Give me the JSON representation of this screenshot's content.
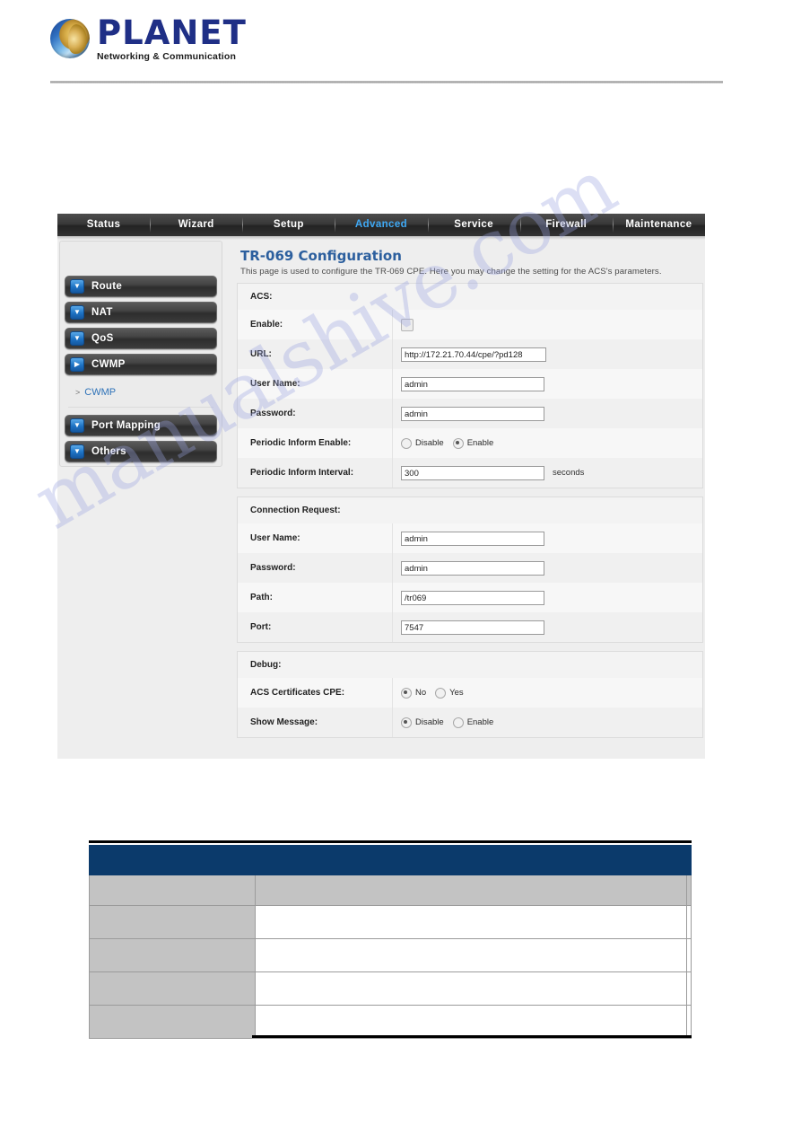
{
  "brand": {
    "name": "PLANET",
    "tagline": "Networking & Communication",
    "logo_icon": "globe-icon"
  },
  "navbar": {
    "tabs": [
      {
        "label": "Status",
        "active": false
      },
      {
        "label": "Wizard",
        "active": false
      },
      {
        "label": "Setup",
        "active": false
      },
      {
        "label": "Advanced",
        "active": true
      },
      {
        "label": "Service",
        "active": false
      },
      {
        "label": "Firewall",
        "active": false
      },
      {
        "label": "Maintenance",
        "active": false
      }
    ],
    "active_color": "#3fa9f5"
  },
  "sidebar": {
    "items": [
      {
        "label": "Route",
        "icon": "chevron-down-icon"
      },
      {
        "label": "NAT",
        "icon": "chevron-down-icon"
      },
      {
        "label": "QoS",
        "icon": "chevron-down-icon"
      },
      {
        "label": "CWMP",
        "icon": "chevron-right-icon"
      }
    ],
    "sub_items": [
      {
        "label": "CWMP",
        "marker": ">"
      }
    ],
    "items2": [
      {
        "label": "Port Mapping",
        "icon": "chevron-down-icon"
      },
      {
        "label": "Others",
        "icon": "chevron-down-icon"
      }
    ]
  },
  "page": {
    "title": "TR-069 Configuration",
    "description": "This page is used to configure the TR-069 CPE. Here you may change the setting for the ACS's parameters.",
    "title_color": "#2c5f9e"
  },
  "acs": {
    "group_label": "ACS:",
    "enable_label": "Enable:",
    "enable_checked": false,
    "url_label": "URL:",
    "url_value": "http://172.21.70.44/cpe/?pd128",
    "username_label": "User Name:",
    "username_value": "admin",
    "password_label": "Password:",
    "password_value": "admin",
    "periodic_inform_label": "Periodic Inform Enable:",
    "periodic_inform_options": [
      "Disable",
      "Enable"
    ],
    "periodic_inform_selected": "Enable",
    "interval_label": "Periodic Inform Interval:",
    "interval_value": "300",
    "interval_unit": "seconds"
  },
  "connection_request": {
    "group_label": "Connection Request:",
    "username_label": "User Name:",
    "username_value": "admin",
    "password_label": "Password:",
    "password_value": "admin",
    "path_label": "Path:",
    "path_value": "/tr069",
    "port_label": "Port:",
    "port_value": "7547"
  },
  "debug": {
    "group_label": "Debug:",
    "acs_cert_label": "ACS Certificates CPE:",
    "acs_cert_options": [
      "No",
      "Yes"
    ],
    "acs_cert_selected": "No",
    "show_message_label": "Show Message:",
    "show_message_options": [
      "Disable",
      "Enable"
    ],
    "show_message_selected": "Disable"
  },
  "watermark": {
    "text": "manualshive.com",
    "color": "#9aa4e0"
  },
  "bottom_table": {
    "header": [
      "",
      ""
    ],
    "rows": [
      [
        "",
        ""
      ],
      [
        "",
        ""
      ],
      [
        "",
        ""
      ],
      [
        "",
        ""
      ],
      [
        "",
        ""
      ]
    ],
    "header_color": "#0b3a6b",
    "label_cell_color": "#c3c3c3"
  }
}
